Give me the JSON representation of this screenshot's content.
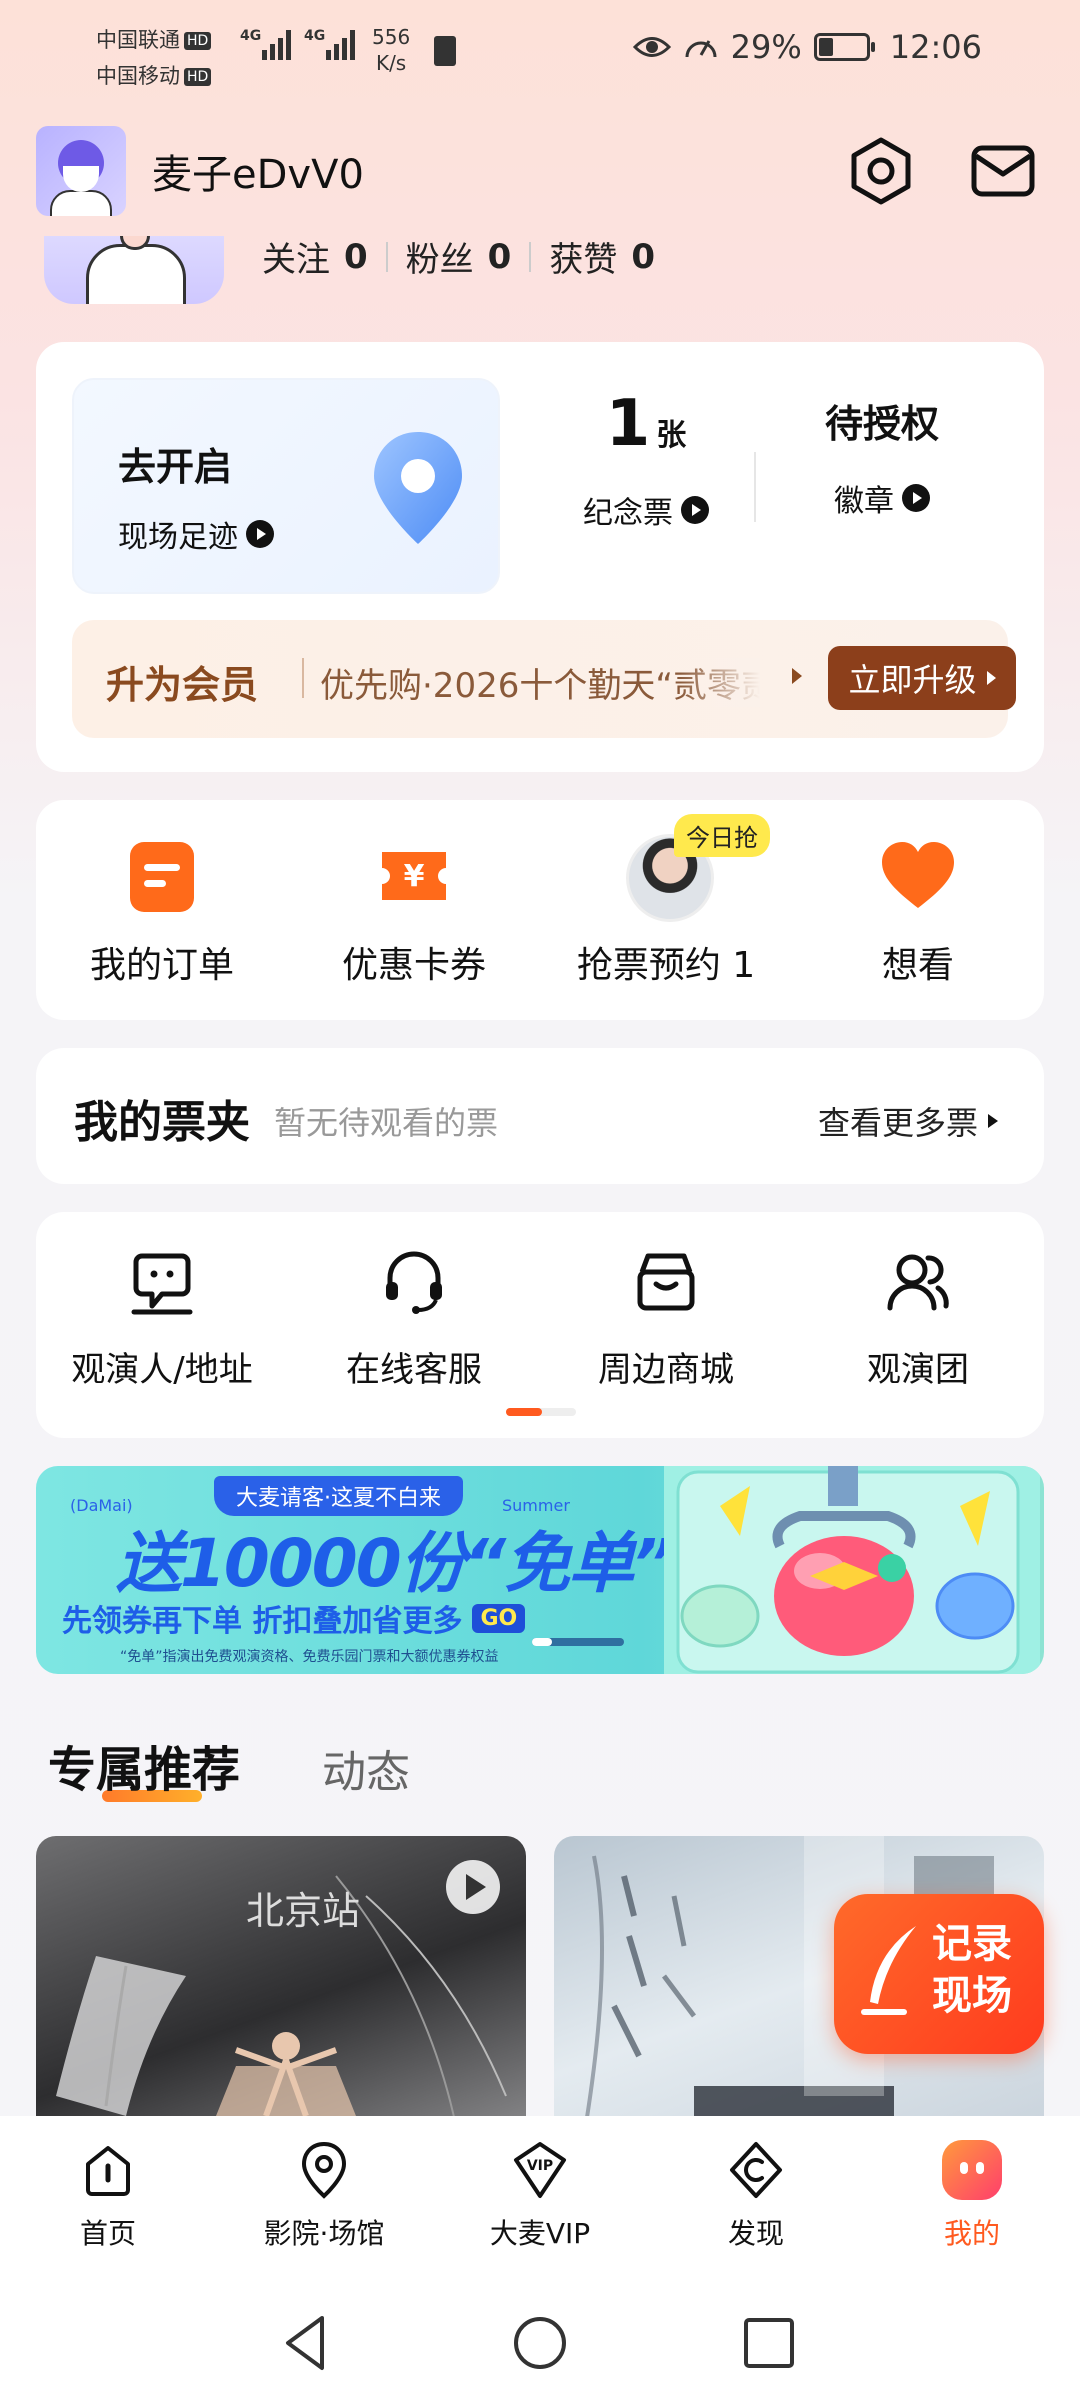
{
  "status_bar": {
    "carrier1": "中国联通",
    "carrier2": "中国移动",
    "hd": "HD",
    "net1": "4G",
    "net2": "4G",
    "speed_value": "556",
    "speed_unit": "K/s",
    "battery": "29%",
    "time": "12:06"
  },
  "header": {
    "username": "麦子eDvV0",
    "follow_label": "关注",
    "follow_count": "0",
    "fans_label": "粉丝",
    "fans_count": "0",
    "likes_label": "获赞",
    "likes_count": "0"
  },
  "overview": {
    "footprint_title": "去开启",
    "footprint_link": "现场足迹",
    "tickets_count": "1",
    "tickets_unit": "张",
    "tickets_link": "纪念票",
    "badge_title": "待授权",
    "badge_link": "徽章",
    "member_title": "升为会员",
    "member_text": "优先购·2026十个勤天“贰零贰",
    "upgrade_label": "立即升级"
  },
  "quick_actions": [
    {
      "label": "我的订单",
      "icon": "order-icon"
    },
    {
      "label": "优惠卡券",
      "icon": "coupon-icon"
    },
    {
      "label": "抢票预约 1",
      "icon": "avatar",
      "badge": "今日抢"
    },
    {
      "label": "想看",
      "icon": "heart-icon"
    }
  ],
  "ticket_folder": {
    "title": "我的票夹",
    "subtitle": "暂无待观看的票",
    "more": "查看更多票"
  },
  "services": [
    {
      "label": "观演人/地址",
      "icon": "viewer-icon"
    },
    {
      "label": "在线客服",
      "icon": "headset-icon"
    },
    {
      "label": "周边商城",
      "icon": "shop-icon"
    },
    {
      "label": "观演团",
      "icon": "group-icon"
    }
  ],
  "banner": {
    "tag": "大麦请客·这夏不白来",
    "brand": "(DaMai)",
    "season": "Summer",
    "main": "送10000份“免单”",
    "line": "先领券再下单 折扣叠加省更多",
    "go": "GO",
    "note": "“免单”指演出免费观演资格、免费乐园门票和大额优惠券权益"
  },
  "tabs": {
    "recommend": "专属推荐",
    "dynamic": "动态"
  },
  "feed": {
    "card1_title": "北京站"
  },
  "record_fab": {
    "line1": "记录",
    "line2": "现场"
  },
  "bottom_nav": [
    {
      "label": "首页",
      "icon": "home-icon"
    },
    {
      "label": "影院·场馆",
      "icon": "location-icon"
    },
    {
      "label": "大麦VIP",
      "icon": "vip-icon"
    },
    {
      "label": "发现",
      "icon": "discover-icon"
    },
    {
      "label": "我的",
      "icon": "mine-icon",
      "active": true
    }
  ],
  "colors": {
    "accent": "#ff5a1f",
    "member_brown": "#8c3f1b",
    "banner_blue": "#1e5ee8"
  }
}
